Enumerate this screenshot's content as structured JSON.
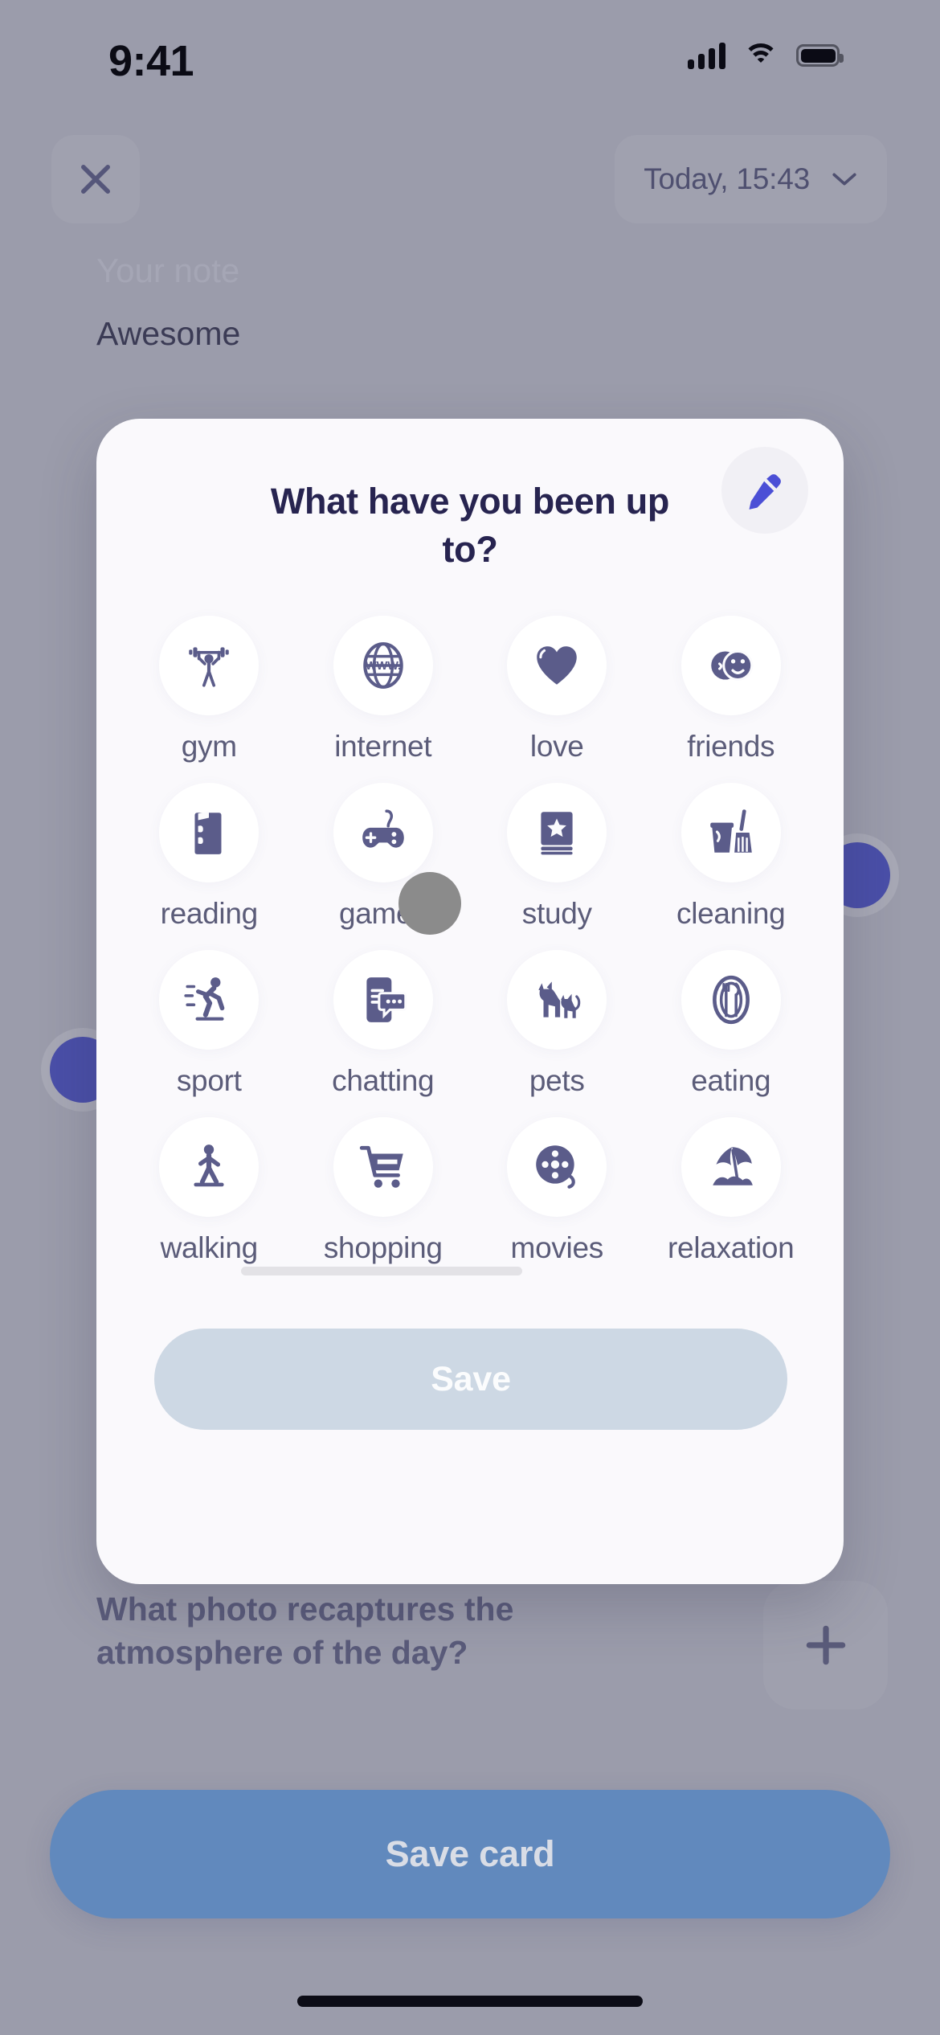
{
  "status_bar": {
    "time": "9:41",
    "cellular_icon": "signal-bars-icon",
    "wifi_icon": "wifi-icon",
    "battery_icon": "battery-icon"
  },
  "header": {
    "close_icon": "close-icon",
    "date_label": "Today, 15:43",
    "chevron_icon": "chevron-down-icon"
  },
  "note": {
    "label": "Your note",
    "value": "Awesome"
  },
  "photo_section": {
    "question": "What photo recaptures the atmosphere of the day?",
    "add_icon": "plus-icon"
  },
  "footer": {
    "save_card_label": "Save card"
  },
  "modal": {
    "title": "What have you been up to?",
    "edit_icon": "pencil-icon",
    "save_label": "Save",
    "activities": [
      {
        "label": "gym",
        "icon": "weightlifting-icon"
      },
      {
        "label": "internet",
        "icon": "globe-www-icon"
      },
      {
        "label": "love",
        "icon": "heart-icon"
      },
      {
        "label": "friends",
        "icon": "friends-faces-icon"
      },
      {
        "label": "reading",
        "icon": "book-icon"
      },
      {
        "label": "games",
        "icon": "gamepad-icon"
      },
      {
        "label": "study",
        "icon": "study-book-star-icon"
      },
      {
        "label": "cleaning",
        "icon": "bucket-broom-icon"
      },
      {
        "label": "sport",
        "icon": "running-icon"
      },
      {
        "label": "chatting",
        "icon": "phone-chat-icon"
      },
      {
        "label": "pets",
        "icon": "cat-dog-icon"
      },
      {
        "label": "eating",
        "icon": "fork-knife-plate-icon"
      },
      {
        "label": "walking",
        "icon": "walking-person-icon"
      },
      {
        "label": "shopping",
        "icon": "shopping-cart-icon"
      },
      {
        "label": "movies",
        "icon": "film-reel-icon"
      },
      {
        "label": "relaxation",
        "icon": "beach-umbrella-icon"
      }
    ]
  },
  "colors": {
    "backdrop": "#9b9cab",
    "modal_surface": "#faf9fc",
    "title_text": "#272450",
    "icon_purple": "#5b5c8a",
    "accent_blue": "#4b4fd6",
    "save_button": "#cdd8e4",
    "save_card_button": "#6189bd",
    "decor_circle": "#4a4fa8"
  }
}
